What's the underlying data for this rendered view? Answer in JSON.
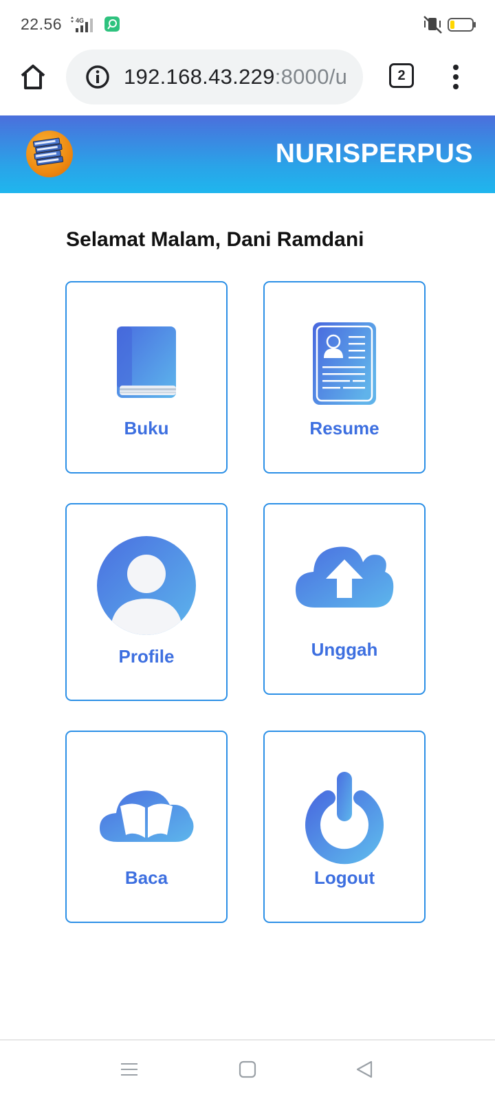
{
  "status_bar": {
    "time": "22.56",
    "network": "4G",
    "battery_color": "#ffd600"
  },
  "browser": {
    "url_host": "192.168.43.229",
    "url_rest": ":8000/u",
    "tab_count": "2"
  },
  "header": {
    "brand": "NURISPERPUS"
  },
  "main": {
    "greeting": "Selamat Malam, Dani Ramdani",
    "menu": [
      {
        "label": "Buku",
        "icon": "book-icon"
      },
      {
        "label": "Resume",
        "icon": "resume-icon"
      },
      {
        "label": "Profile",
        "icon": "profile-icon"
      },
      {
        "label": "Unggah",
        "icon": "cloud-upload-icon"
      },
      {
        "label": "Baca",
        "icon": "cloud-book-icon"
      },
      {
        "label": "Logout",
        "icon": "power-icon"
      }
    ]
  },
  "colors": {
    "accent": "#3d6fe0",
    "card_border": "#2b8fe6",
    "header_top": "#4b6fdc",
    "header_bottom": "#1fb6ee"
  }
}
